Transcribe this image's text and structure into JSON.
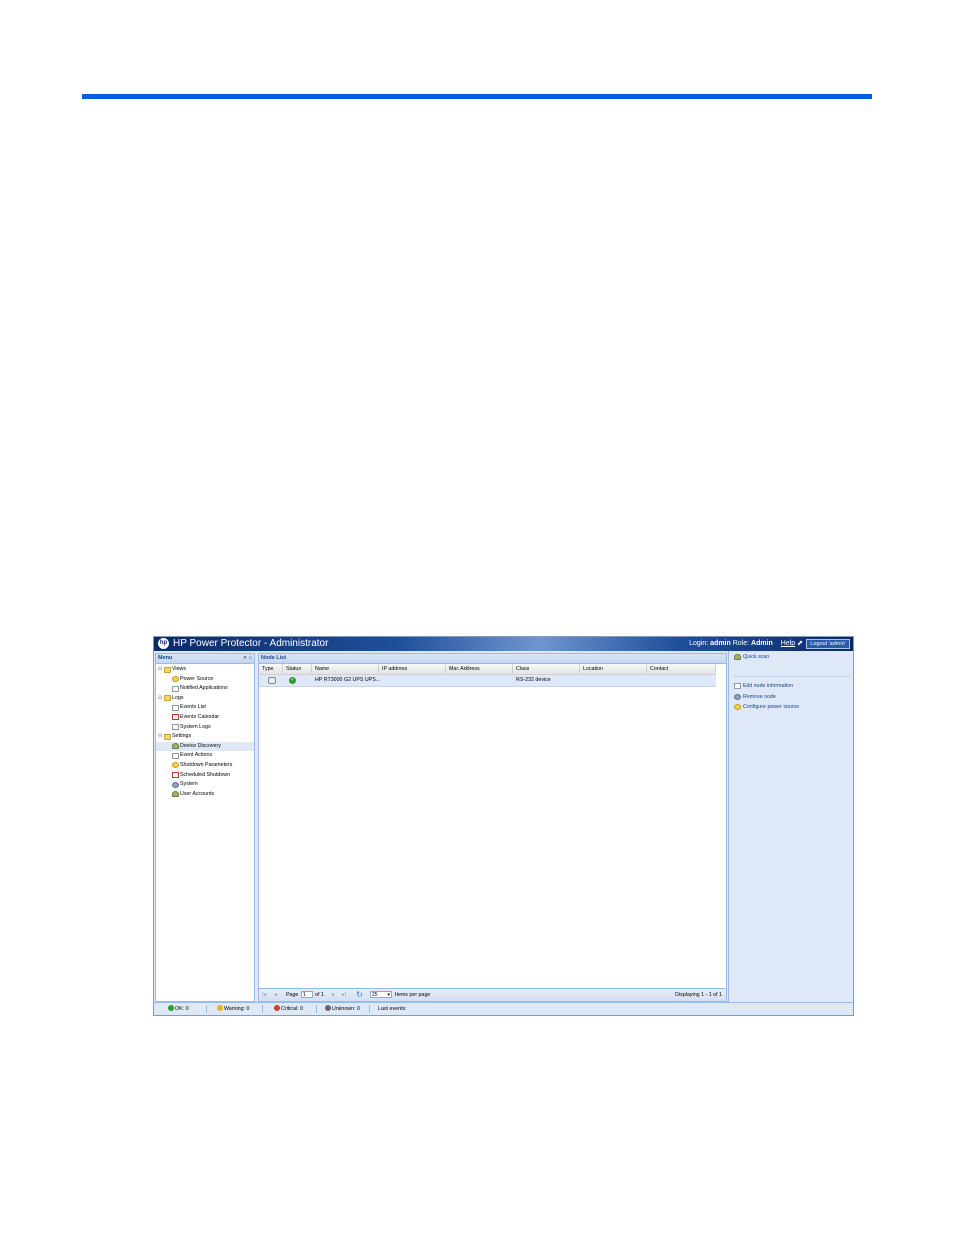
{
  "window": {
    "title": "HP Power Protector - Administrator",
    "logo": "hp-logo"
  },
  "header": {
    "login_label": "Login:",
    "login_value": "admin",
    "role_label": "Role:",
    "role_value": "Admin",
    "help": "Help",
    "logout": "Logout 'admin'"
  },
  "menu": {
    "title": "Menu",
    "items": [
      {
        "label": "Views"
      },
      {
        "label": "Power Source"
      },
      {
        "label": "Notified Applications"
      },
      {
        "label": "Logs"
      },
      {
        "label": "Events List"
      },
      {
        "label": "Events Calendar"
      },
      {
        "label": "System Logs"
      },
      {
        "label": "Settings"
      },
      {
        "label": "Device Discovery"
      },
      {
        "label": "Event Actions"
      },
      {
        "label": "Shutdown Parameters"
      },
      {
        "label": "Scheduled Shutdown"
      },
      {
        "label": "System"
      },
      {
        "label": "User Accounts"
      }
    ]
  },
  "grid": {
    "title": "Node List",
    "columns": [
      "Type",
      "Status",
      "Name",
      "IP address",
      "Mac Address",
      "Class",
      "Location",
      "Contact"
    ],
    "rows": [
      {
        "name": "HP RT3000 G2 UPS UPS...",
        "ip": "",
        "mac": "",
        "class": "RS-232 device",
        "location": "",
        "contact": ""
      }
    ],
    "paging": {
      "page_label": "Page",
      "page_value": "1",
      "of_label": "of 1",
      "per_page_value": "25",
      "per_page_label": "Items per page",
      "displaying": "Displaying 1 - 1 of 1"
    }
  },
  "actions": {
    "items": [
      {
        "label": "Quick scan"
      },
      {
        "label": "Edit node information"
      },
      {
        "label": "Remove node"
      },
      {
        "label": "Configure power source"
      }
    ]
  },
  "statusbar": {
    "ok": "OK: 0",
    "warning": "Warning: 0",
    "critical": "Critical: 0",
    "unknown": "Unknown: 0",
    "last_events": "Last events:"
  },
  "colors": {
    "accent_rule": "#0a5ae6",
    "ok": "#2f9b2f",
    "warning": "#e8b41c",
    "critical": "#d53a2a",
    "unknown": "#666666"
  }
}
